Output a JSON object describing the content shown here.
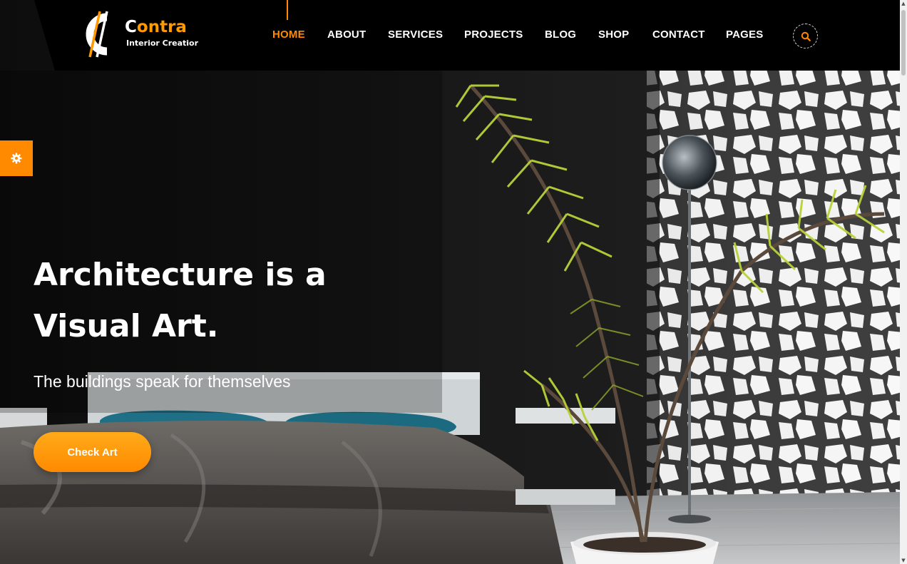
{
  "brand": {
    "title_first_letter": "C",
    "title_rest": "ontra",
    "tagline": "Interior Creatior",
    "accent_color": "#ff8a00",
    "logo_icon": "contra-logo-icon"
  },
  "nav": {
    "items": [
      {
        "label": "HOME",
        "active": true
      },
      {
        "label": "ABOUT",
        "active": false
      },
      {
        "label": "SERVICES",
        "active": false
      },
      {
        "label": "PROJECTS",
        "active": false
      },
      {
        "label": "BLOG",
        "active": false
      },
      {
        "label": "SHOP",
        "active": false
      },
      {
        "label": "CONTACT",
        "active": false
      },
      {
        "label": "PAGES",
        "active": false
      }
    ],
    "search_icon": "search-icon"
  },
  "settings_tab": {
    "icon": "gear-icon"
  },
  "hero": {
    "title_line1": "Architecture is a",
    "title_line2": "Visual Art.",
    "subtitle": "The buildings speak for themselves",
    "cta_label": "Check Art"
  }
}
